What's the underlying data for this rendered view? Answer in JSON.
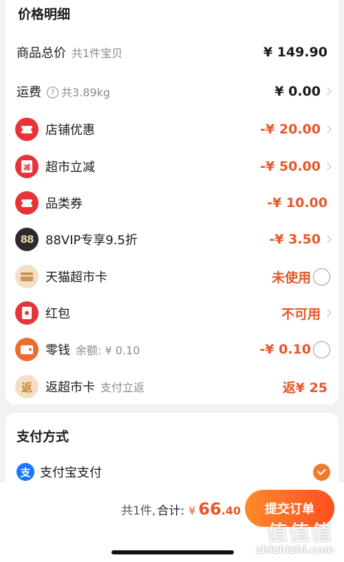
{
  "price_section": {
    "title": "价格明细",
    "rows": [
      {
        "label": "商品总价",
        "sub": "共1件宝贝",
        "value": "¥ 149.90"
      },
      {
        "label": "运费",
        "sub": "共3.89kg",
        "value": "¥ 0.00"
      },
      {
        "label": "店铺优惠",
        "value": "-¥ 20.00"
      },
      {
        "label": "超市立减",
        "value": "-¥ 50.00",
        "icon_text": "减"
      },
      {
        "label": "品类券",
        "value": "-¥ 10.00"
      },
      {
        "label": "88VIP专享9.5折",
        "value": "-¥ 3.50",
        "icon_text": "88"
      },
      {
        "label": "天猫超市卡",
        "value": "未使用"
      },
      {
        "label": "红包",
        "value": "不可用"
      },
      {
        "label": "零钱",
        "sub": "余额: ¥ 0.10",
        "value": "-¥ 0.10"
      },
      {
        "label": "返超市卡",
        "sub": "支付立返",
        "value": "返¥ 25",
        "icon_text": "返"
      }
    ]
  },
  "payment_section": {
    "title": "支付方式",
    "method": "支付宝支付",
    "icon_text": "支"
  },
  "bottom_bar": {
    "count_text": "共1件,",
    "total_label": "合计:",
    "currency": "¥",
    "total_int": "66",
    "total_dec": ".40",
    "submit_label": "提交订单",
    "watermark": "值值值",
    "watermark_url": "zhizhizhi.com"
  },
  "colors": {
    "accent": "#e8562a",
    "icon_red": "#e8333a",
    "alipay_blue": "#1677ff"
  }
}
